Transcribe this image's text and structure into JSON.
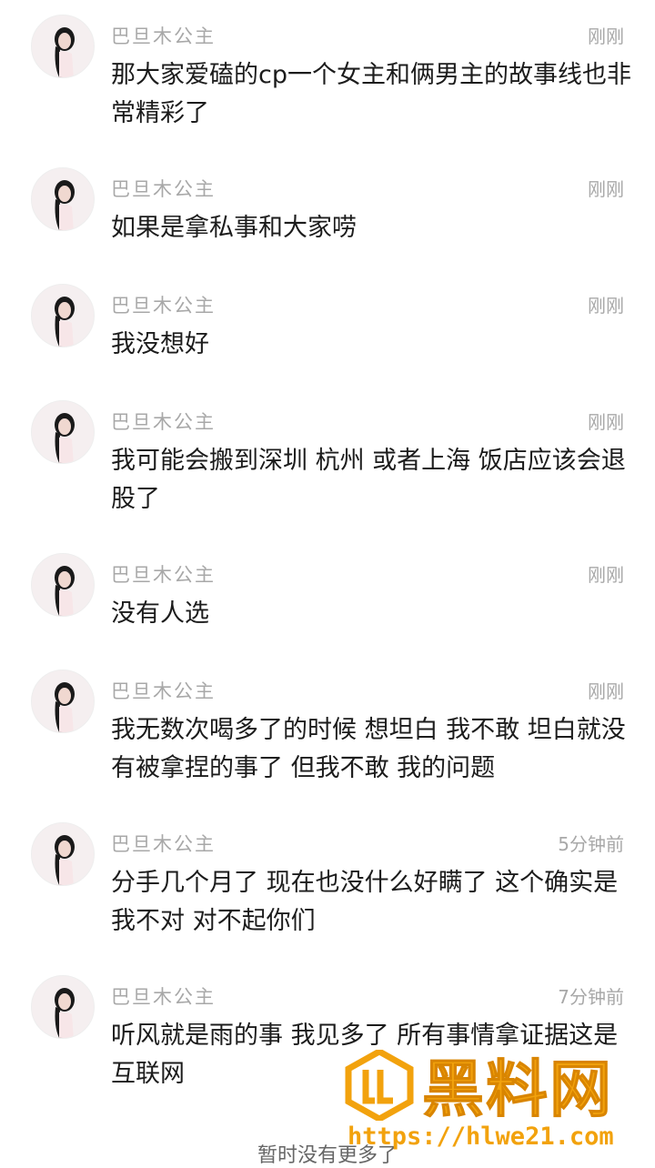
{
  "comments": [
    {
      "user": "巴旦木公主",
      "time": "刚刚",
      "text": "那大家爱磕的cp一个女主和俩男主的故事线也非常精彩了"
    },
    {
      "user": "巴旦木公主",
      "time": "刚刚",
      "text": "如果是拿私事和大家唠"
    },
    {
      "user": "巴旦木公主",
      "time": "刚刚",
      "text": "我没想好"
    },
    {
      "user": "巴旦木公主",
      "time": "刚刚",
      "text": "我可能会搬到深圳 杭州 或者上海 饭店应该会退股了"
    },
    {
      "user": "巴旦木公主",
      "time": "刚刚",
      "text": "没有人选"
    },
    {
      "user": "巴旦木公主",
      "time": "刚刚",
      "text": "我无数次喝多了的时候 想坦白 我不敢 坦白就没有被拿捏的事了 但我不敢 我的问题"
    },
    {
      "user": "巴旦木公主",
      "time": "5分钟前",
      "text": "分手几个月了 现在也没什么好瞒了 这个确实是我不对 对不起你们"
    },
    {
      "user": "巴旦木公主",
      "time": "7分钟前",
      "text": "听风就是雨的事 我见多了 所有事情拿证据这是互联网"
    }
  ],
  "footer": "暂时没有更多了",
  "watermark": {
    "title": "黑料网",
    "url": "https://hlwe21.com",
    "color": "#f2a20d"
  }
}
